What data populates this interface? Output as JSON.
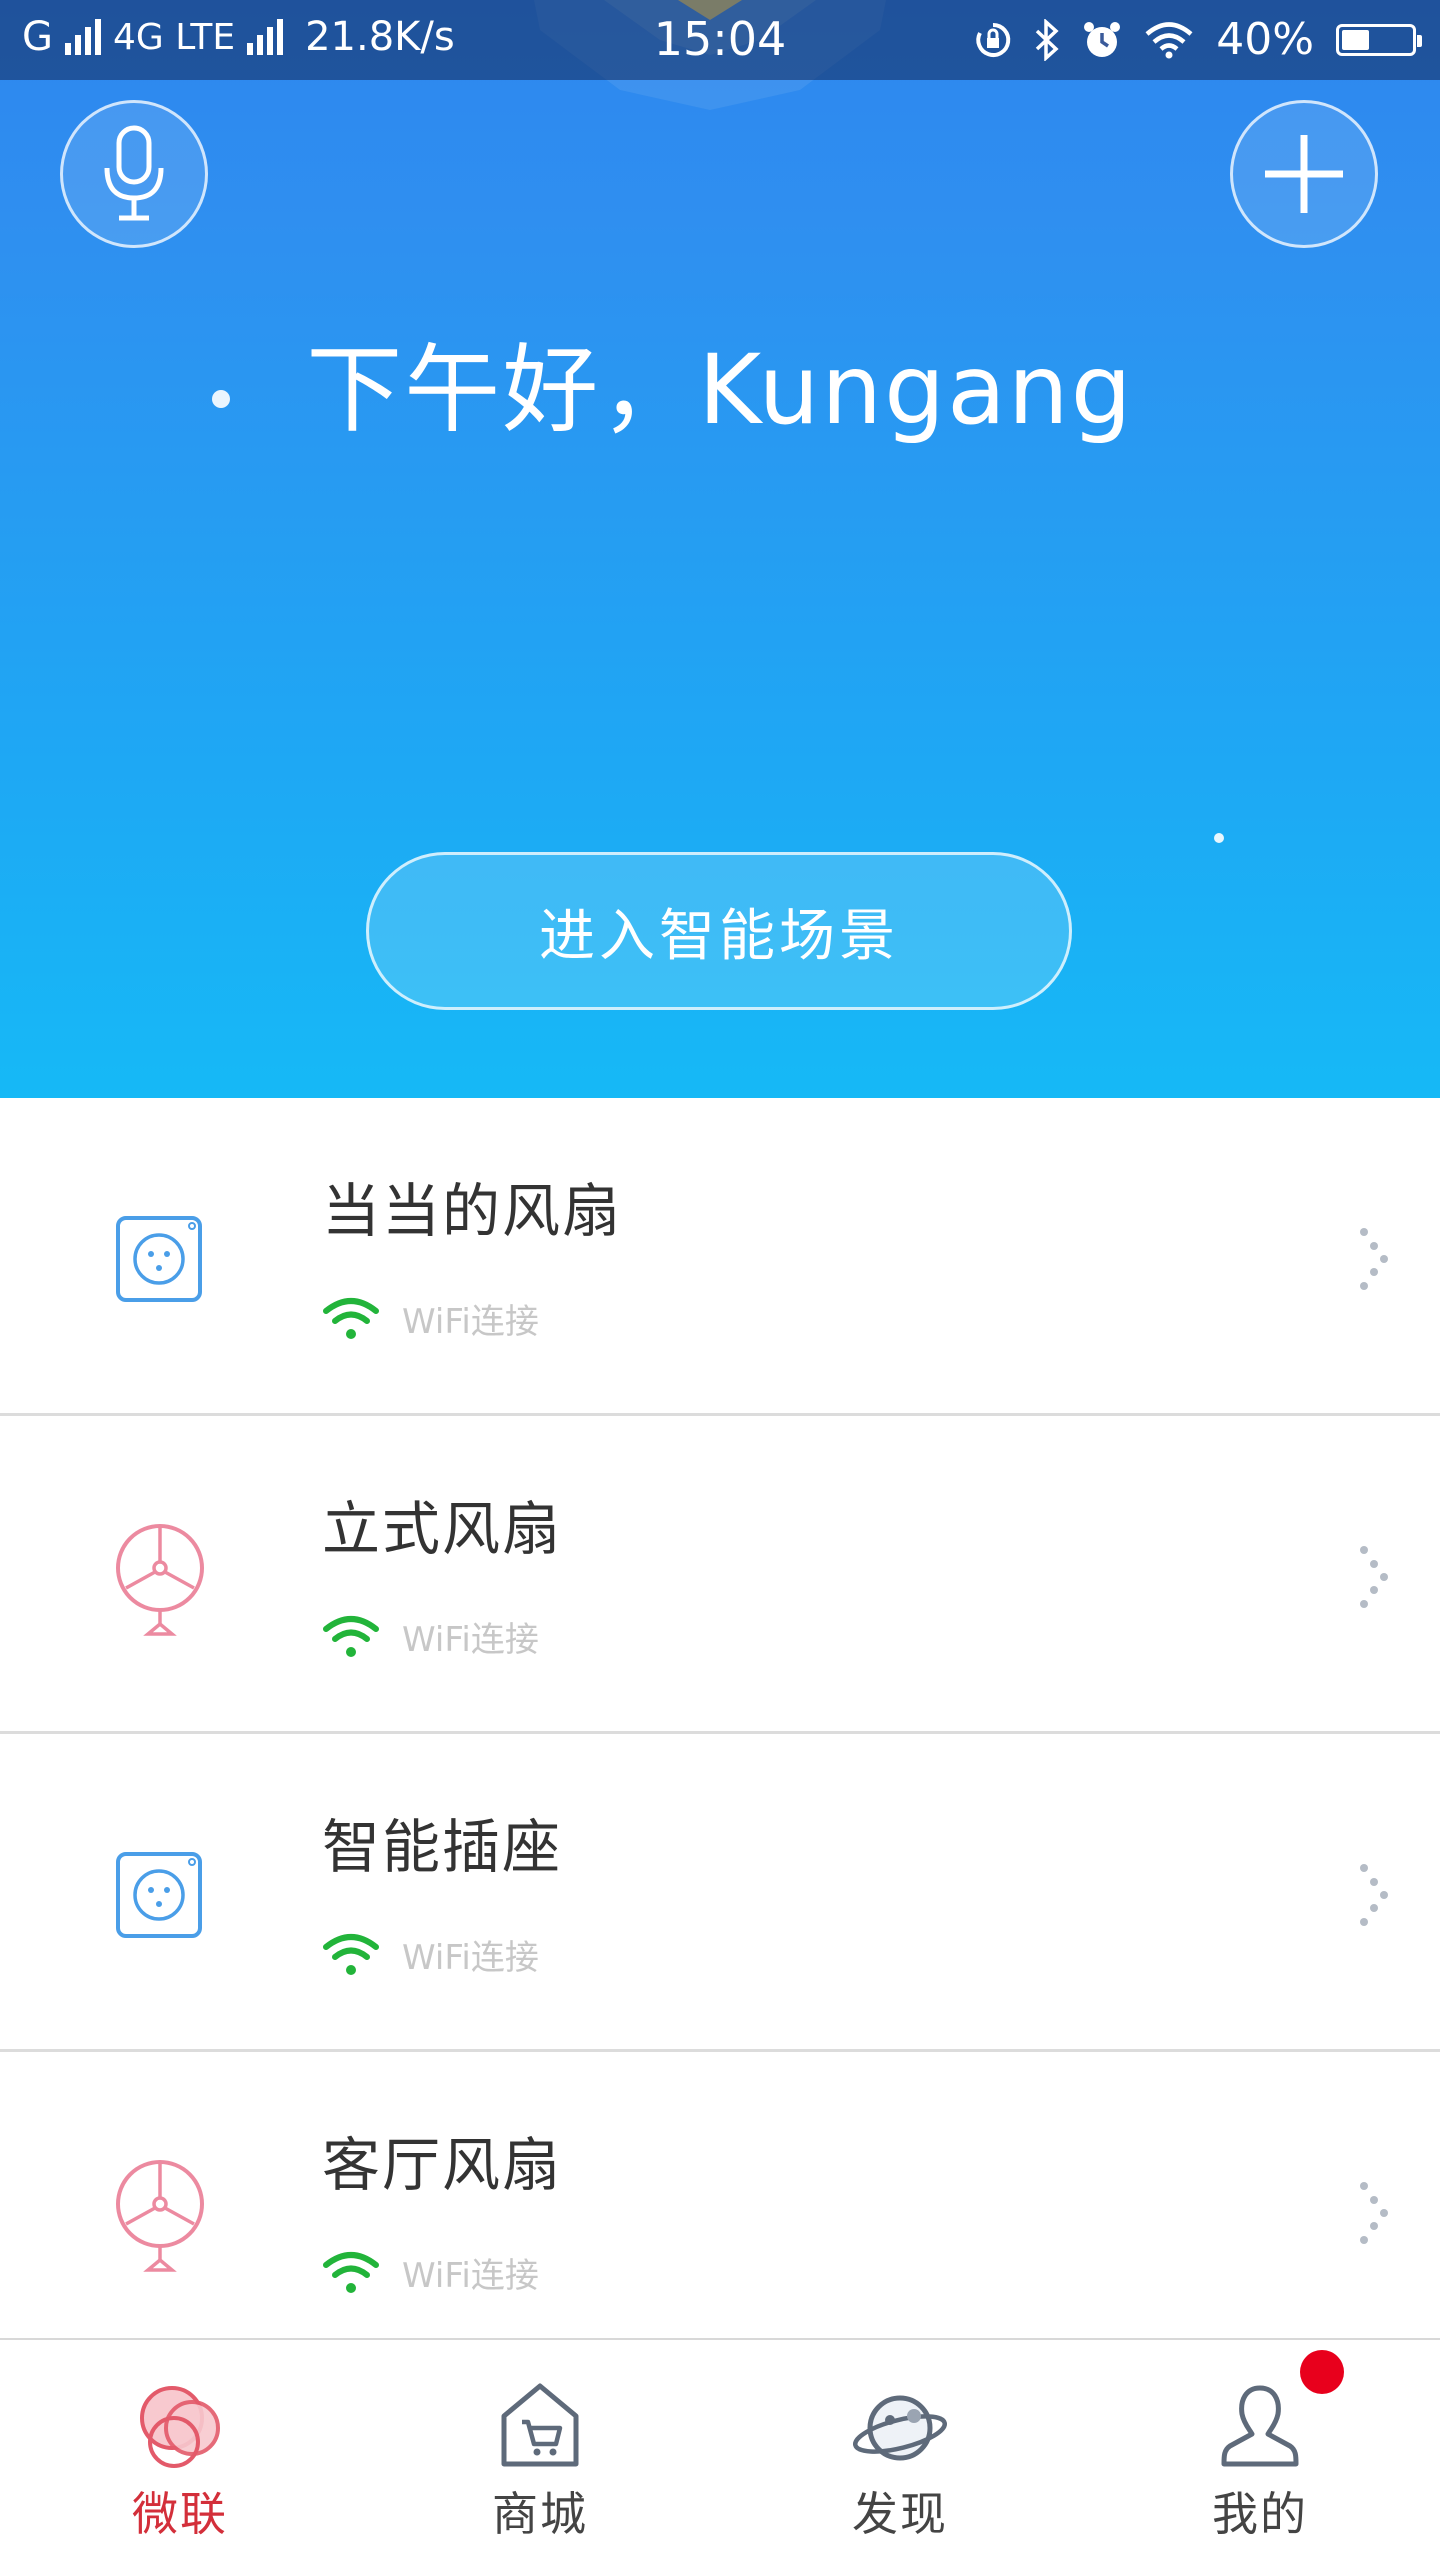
{
  "status_bar": {
    "carrier_signal_1": "G",
    "network": "4G LTE",
    "speed": "21.8K/s",
    "time": "15:04",
    "battery": "40%",
    "battery_level": 0.4,
    "icons": [
      "rotation-lock-icon",
      "bluetooth-icon",
      "alarm-icon",
      "wifi-icon"
    ]
  },
  "header": {
    "greeting": "下午好，Kungang",
    "voice_icon": "microphone-icon",
    "add_icon": "plus-icon",
    "scene_button": "进入智能场景"
  },
  "devices": [
    {
      "name": "当当的风扇",
      "type_icon": "smart-socket-icon",
      "connection": "WiFi连接"
    },
    {
      "name": "立式风扇",
      "type_icon": "standing-fan-icon",
      "connection": "WiFi连接"
    },
    {
      "name": "智能插座",
      "type_icon": "smart-socket-icon",
      "connection": "WiFi连接"
    },
    {
      "name": "客厅风扇",
      "type_icon": "standing-fan-icon",
      "connection": "WiFi连接"
    }
  ],
  "tabs": [
    {
      "label": "微联",
      "icon": "weilian-logo-icon",
      "active": true
    },
    {
      "label": "商城",
      "icon": "shop-icon",
      "active": false
    },
    {
      "label": "发现",
      "icon": "planet-icon",
      "active": false
    },
    {
      "label": "我的",
      "icon": "user-icon",
      "active": false,
      "has_badge": true
    }
  ],
  "colors": {
    "hero_top": "#2d86ee",
    "hero_bottom": "#16b9f6",
    "wifi_green": "#22b43a",
    "active_tab": "#d32f3a",
    "badge": "#e8001c",
    "socket_blue": "#4a9ee8",
    "fan_pink": "#ec8aa0"
  }
}
